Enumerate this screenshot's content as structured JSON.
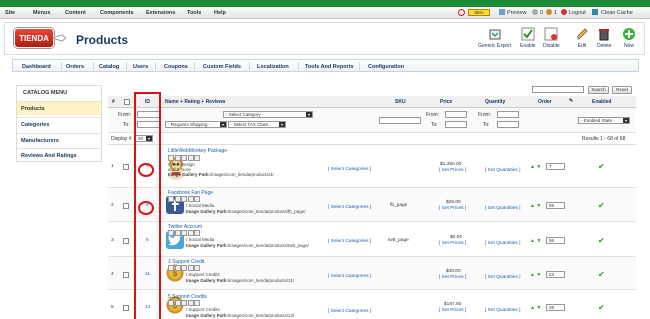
{
  "menubar": {
    "items": [
      "Site",
      "Menus",
      "Content",
      "Components",
      "Extensions",
      "Tools",
      "Help"
    ],
    "right": {
      "progress": "86%",
      "preview": "Preview",
      "msgs": "0",
      "users": "1",
      "logout": "Logout",
      "clean": "Clean Cache"
    }
  },
  "logo": {
    "text": "TIENDA"
  },
  "page": {
    "title": "Products"
  },
  "toolbar": {
    "generic_export": "Generic Export",
    "enable": "Enable",
    "disable": "Disable",
    "edit": "Edit",
    "delete": "Delete",
    "new": "New"
  },
  "subnav": [
    "Dashboard",
    "Orders",
    "Catalog",
    "Users",
    "Coupons",
    "Custom Fields",
    "Localization",
    "Tools And Reports",
    "Configuration"
  ],
  "sidebar": {
    "title": "CATALOG MENU",
    "items": [
      "Products",
      "Categories",
      "Manufacturers",
      "Reviews And Ratings"
    ]
  },
  "search": {
    "value": "",
    "search_btn": "Search",
    "reset_btn": "Reset"
  },
  "grid": {
    "headers": {
      "num": "#",
      "id": "ID",
      "name": "Name + Rating + Reviews",
      "sku": "SKU",
      "price": "Price",
      "quantity": "Quantity",
      "order": "Order",
      "enabled": "Enabled"
    },
    "filters": {
      "from": "From:",
      "to": "To:",
      "category": "- Select Category -",
      "shipping": "- Requires Shipping -",
      "tax": "- Select TAX Class -",
      "state": "- Enabled State -"
    },
    "display": {
      "label": "Display #",
      "value": "20"
    },
    "results": "Results 1 - 68 of 68",
    "rows": [
      {
        "num": "1",
        "id": "4",
        "name": "LittleWebMonkey Package",
        "cats": "/ Web Design",
        "more": "and 2 more",
        "path_label": "Image Gallery Path:",
        "path": "/images/com_tienda/products/4/",
        "sku": "",
        "price": "$1,350.00",
        "ordering": "7",
        "set_cat": "[ Select Categories ]",
        "set_price": "[ Set Prices ]",
        "set_qty": "[ Set Quantities ]"
      },
      {
        "num": "2",
        "id": "5",
        "name": "Facebook Fan Page",
        "cats": "/ Social Media",
        "more": "",
        "path_label": "Image Gallery Path:",
        "path": "/images/com_tienda/products/fb_page/",
        "sku": "fb_page",
        "price": "$25.00",
        "ordering": "56",
        "set_cat": "[ Select Categories ]",
        "set_price": "[ Set Prices ]",
        "set_qty": "[ Set Quantities ]"
      },
      {
        "num": "3",
        "id": "6",
        "name": "Twitter Account",
        "cats": "/ Social Media",
        "more": "",
        "path_label": "Image Gallery Path:",
        "path": "/images/com_tienda/products/twtt_page/",
        "sku": "twtt_page",
        "price": "$0.00",
        "ordering": "56",
        "set_cat": "[ Select Categories ]",
        "set_price": "[ Set Prices ]",
        "set_qty": "[ Set Quantities ]"
      },
      {
        "num": "4",
        "id": "11",
        "name": "1 Support Credit",
        "cats": "/ Support Credits",
        "more": "",
        "path_label": "Image Gallery Path:",
        "path": "/images/com_tienda/products/11/",
        "sku": "",
        "price": "$40.00",
        "ordering": "23",
        "set_cat": "[ Select Categories ]",
        "set_price": "[ Set Prices ]",
        "set_qty": "[ Set Quantities ]"
      },
      {
        "num": "5",
        "id": "12",
        "name": "5 Support Credits",
        "cats": "/ Support Credits",
        "more": "",
        "path_label": "Image Gallery Path:",
        "path": "/images/com_tienda/products/12/",
        "sku": "",
        "price": "$187.50",
        "ordering": "26",
        "set_cat": "[ Select Categories ]",
        "set_price": "[ Set Prices ]",
        "set_qty": "[ Set Quantities ]"
      }
    ]
  },
  "colors": {
    "accent": "#1a3a66",
    "highlight": "#dd1111",
    "enabled": "#2a9a2a"
  }
}
